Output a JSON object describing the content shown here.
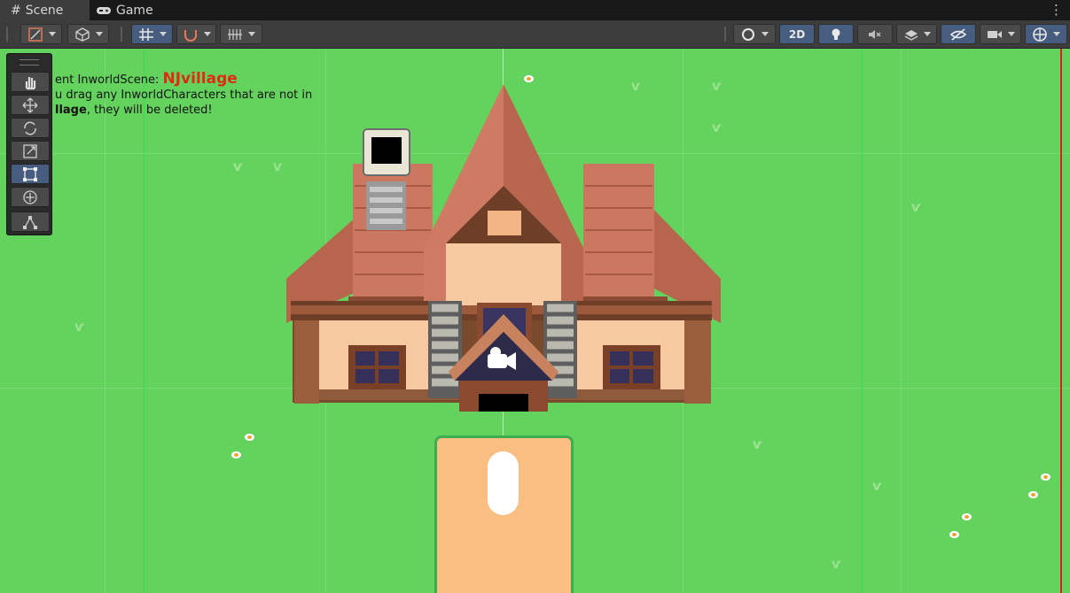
{
  "tabs": [
    {
      "label": "Scene",
      "active": true,
      "icon": "grid-icon"
    },
    {
      "label": "Game",
      "active": false,
      "icon": "gamepad-icon"
    }
  ],
  "toolbar": {
    "mode_2d_label": "2D"
  },
  "scene_info": {
    "line1_prefix": "ent InworldScene: ",
    "scene_name": "NJvillage",
    "line2": "u drag any InworldCharacters that are not in",
    "line3_bold": "llage",
    "line3_rest": ", they will be deleted!"
  },
  "tools": [
    "hand-tool",
    "move-tool",
    "rotate-tool",
    "scale-tool",
    "rect-tool",
    "transform-tool",
    "custom-tool"
  ],
  "colors": {
    "grass": "#63d35e",
    "path": "#f8be82",
    "roof": "#c8705c",
    "wall": "#f4c9a3",
    "accent_blue": "#465d7f",
    "scene_name": "#e12b10"
  }
}
